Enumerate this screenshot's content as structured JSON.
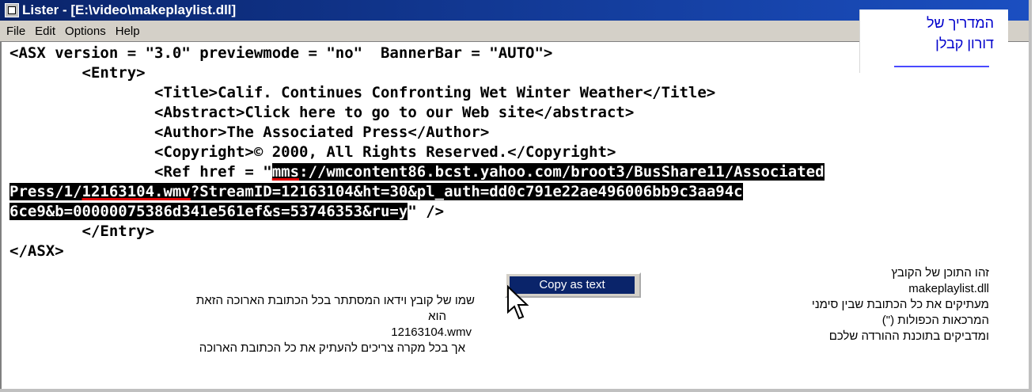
{
  "window": {
    "title": "Lister - [E:\\video\\makeplaylist.dll]"
  },
  "menu": [
    "File",
    "Edit",
    "Options",
    "Help"
  ],
  "guide": {
    "line1": "המדריך של",
    "line2": "דורון קבלן"
  },
  "code": {
    "l1": "<ASX version = \"3.0\" previewmode = \"no\"  BannerBar = \"AUTO\">",
    "l2": "        <Entry>",
    "l3": "                <Title>Calif. Continues Confronting Wet Winter Weather</Title>",
    "l4": "                <Abstract>Click here to go to our Web site</abstract>",
    "l5": "                <Author>The Associated Press</Author>",
    "l6": "                <Copyright>© 2000, All Rights Reserved.</Copyright>",
    "l7_pre": "                <Ref href = \"",
    "l7_mms": "mms",
    "l7_rest": "://wmcontent86.bcst.yahoo.com/broot3/BusShare11/Associated",
    "l8_a": "Press/1/",
    "l8_b": "12163104.wmv",
    "l8_c": "?StreamID=12163104&ht=30&pl_auth=dd0c791e22ae496006bb9c3aa94c",
    "l9_sel": "6ce9&b=00000075386d341e561ef&s=53746353&ru=y",
    "l9_rest": "\" />",
    "l10": "        </Entry>",
    "l11": "</ASX>"
  },
  "context_menu": {
    "item": "Copy as text"
  },
  "notes": {
    "left_line1": "שמו של קובץ וידאו המסתתר בכל הכתובת הארוכה הזאת",
    "left_line2": "הוא",
    "left_line3": "12163104.wmv",
    "left_line4": "אך בכל מקרה צריכים להעתיק את כל הכתובת הארוכה",
    "right_line1": "זהו התוכן של הקובץ",
    "right_line2": "makeplaylist.dll",
    "right_line3": "מעתיקים את כל הכתובת שבין סימני",
    "right_line4": "המרכאות הכפולות (\")",
    "right_line5": "ומדביקים בתוכנת ההורדה שלכם"
  }
}
